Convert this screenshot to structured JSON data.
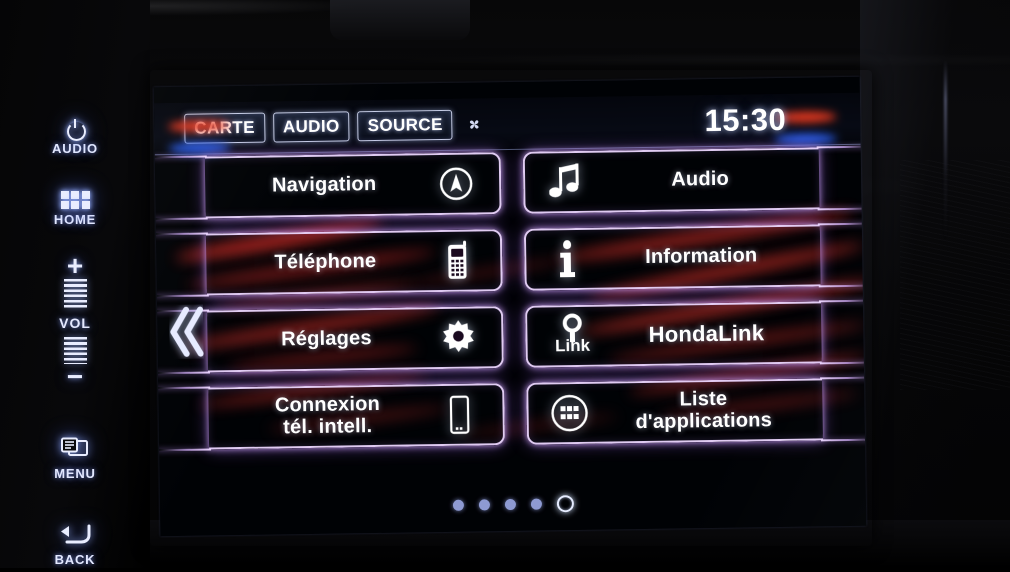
{
  "device": {
    "name": "honda-infotainment-head-unit",
    "screen_title": "Home Menu"
  },
  "hardkeys": [
    {
      "id": "audio-power",
      "label": "AUDIO",
      "icon": "power-icon"
    },
    {
      "id": "home",
      "label": "HOME",
      "icon": "grid-icon"
    },
    {
      "id": "volume",
      "label": "VOL",
      "icon": "volume-rocker-icon",
      "plus": "+",
      "minus": "−"
    },
    {
      "id": "menu",
      "label": "MENU",
      "icon": "menu-icon"
    },
    {
      "id": "back",
      "label": "BACK",
      "icon": "back-arrow-icon"
    }
  ],
  "statusbar": {
    "buttons": [
      {
        "id": "carte",
        "label": "CARTE"
      },
      {
        "id": "audio",
        "label": "AUDIO"
      },
      {
        "id": "source",
        "label": "SOURCE"
      }
    ],
    "fan_icon": "fan-icon",
    "clock": "15:30"
  },
  "menu": {
    "left_column": [
      {
        "id": "navigation",
        "label": "Navigation",
        "icon": "compass-icon"
      },
      {
        "id": "telephone",
        "label": "Téléphone",
        "icon": "phone-icon"
      },
      {
        "id": "reglages",
        "label": "Réglages",
        "icon": "gear-icon"
      },
      {
        "id": "connexion",
        "label": "Connexion\ntél. intell.",
        "icon": "smartphone-icon"
      }
    ],
    "right_column": [
      {
        "id": "audio",
        "label": "Audio",
        "icon": "music-note-icon"
      },
      {
        "id": "information",
        "label": "Information",
        "icon": "info-icon"
      },
      {
        "id": "hondalink",
        "label": "HondaLink",
        "icon": "hondalink-icon",
        "icon_text": "Link"
      },
      {
        "id": "apps",
        "label": "Liste\nd'applications",
        "icon": "app-grid-icon"
      }
    ]
  },
  "pagination": {
    "total": 5,
    "active_index": 5,
    "dots": [
      "1",
      "2",
      "3",
      "4",
      "5"
    ]
  },
  "back_arrow": {
    "id": "back-page-chevron",
    "icon": "double-chevron-left-icon"
  },
  "colors": {
    "tile_outline": "#ecd6ff",
    "tile_glow": "#aa6eff",
    "accent_red": "#e4381f",
    "accent_blue": "#2a5ce8",
    "text": "#ffffff",
    "hardkey_text": "#e4e9ff"
  }
}
